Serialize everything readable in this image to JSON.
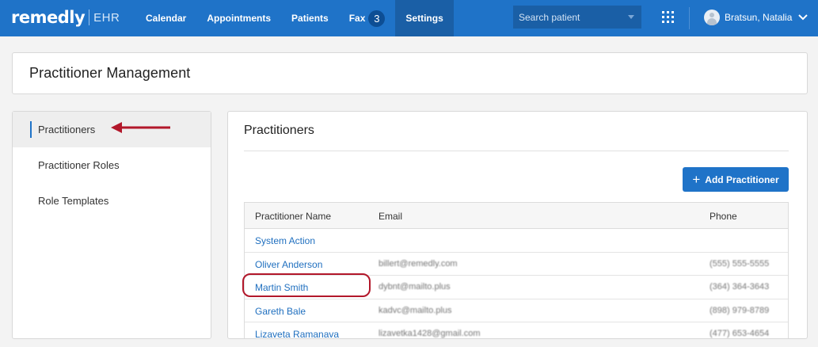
{
  "app": {
    "brand": "remedly",
    "product": "EHR"
  },
  "nav": {
    "items": [
      "Calendar",
      "Appointments",
      "Patients"
    ],
    "fax_label": "Fax",
    "fax_count": "3",
    "settings_label": "Settings"
  },
  "search": {
    "placeholder": "Search patient"
  },
  "user": {
    "name": "Bratsun, Natalia"
  },
  "page": {
    "title": "Practitioner Management"
  },
  "sidebar": {
    "items": [
      {
        "label": "Practitioners"
      },
      {
        "label": "Practitioner Roles"
      },
      {
        "label": "Role Templates"
      }
    ]
  },
  "main": {
    "title": "Practitioners",
    "add_button": "Add Practitioner",
    "columns": {
      "name": "Practitioner Name",
      "email": "Email",
      "phone": "Phone"
    },
    "rows": [
      {
        "name": "System Action",
        "email": "",
        "phone": ""
      },
      {
        "name": "Oliver Anderson",
        "email": "billert@remedly.com",
        "phone": "(555) 555-5555"
      },
      {
        "name": "Martin Smith",
        "email": "dybnt@mailto.plus",
        "phone": "(364) 364-3643"
      },
      {
        "name": "Gareth Bale",
        "email": "kadvc@mailto.plus",
        "phone": "(898) 979-8789"
      },
      {
        "name": "Lizaveta Ramanava",
        "email": "lizavetka1428@gmail.com",
        "phone": "(477) 653-4654"
      }
    ]
  },
  "colors": {
    "primary": "#1f73c8",
    "annotation": "#b2172a"
  }
}
